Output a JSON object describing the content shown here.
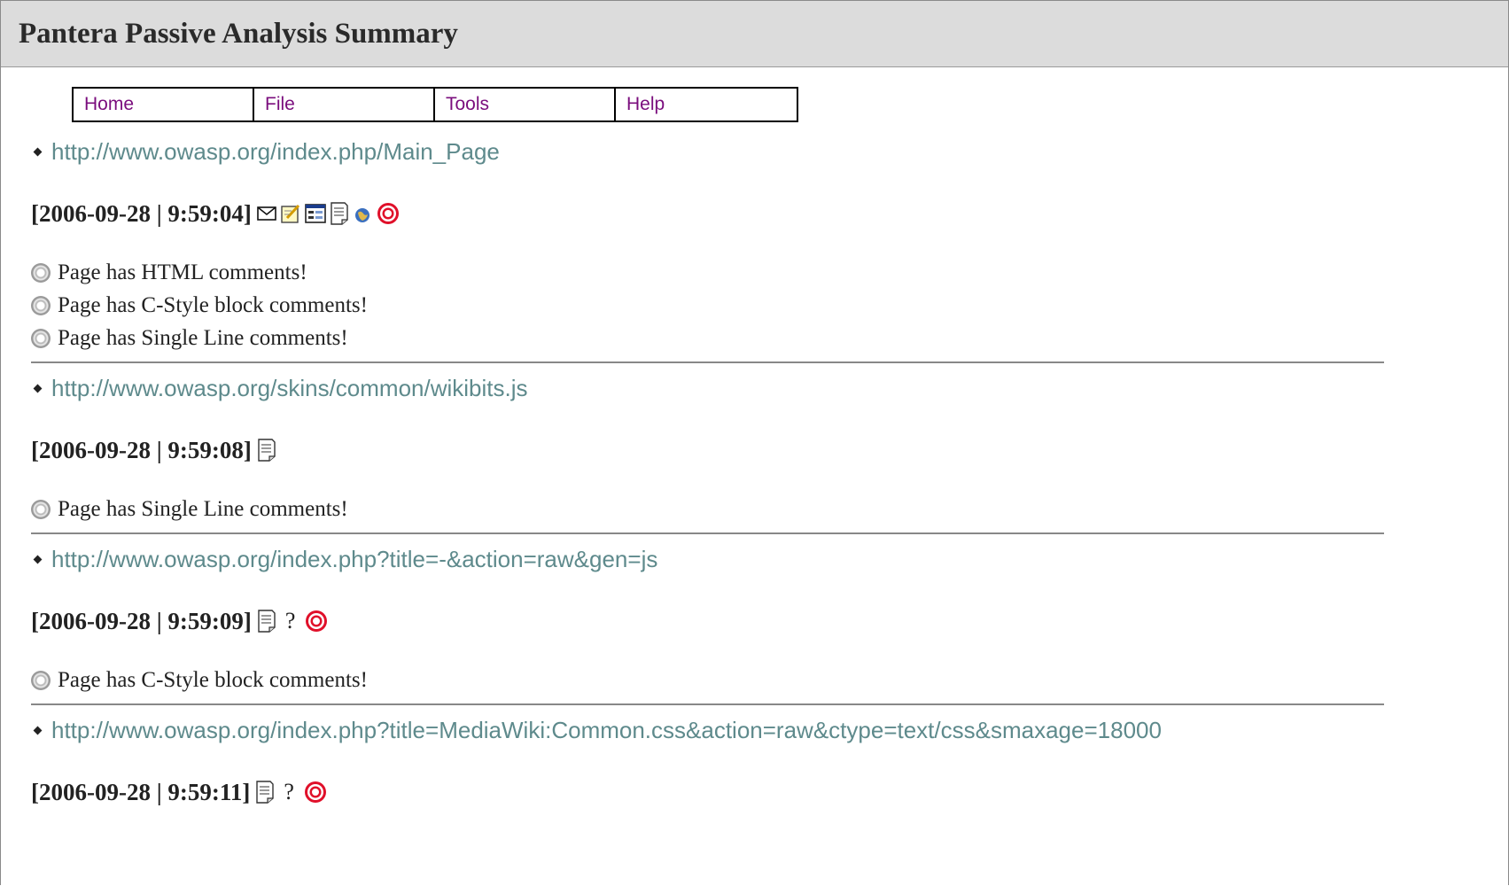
{
  "window": {
    "title": "Pantera Passive Analysis Summary"
  },
  "menu": {
    "items": [
      "Home",
      "File",
      "Tools",
      "Help"
    ]
  },
  "entries": [
    {
      "url": "http://www.owasp.org/index.php/Main_Page",
      "timestamp": "[2006-09-28 | 9:59:04]",
      "icons": [
        "mail-icon",
        "edit-icon",
        "form-icon",
        "document-icon",
        "globe-icon",
        "target-icon"
      ],
      "findings": [
        "Page has HTML comments!",
        "Page has C-Style block comments!",
        "Page has Single Line comments!"
      ]
    },
    {
      "url": "http://www.owasp.org/skins/common/wikibits.js",
      "timestamp": "[2006-09-28 | 9:59:08]",
      "icons": [
        "document-icon"
      ],
      "findings": [
        "Page has Single Line comments!"
      ]
    },
    {
      "url": "http://www.owasp.org/index.php?title=-&action=raw&gen=js",
      "timestamp": "[2006-09-28 | 9:59:09]",
      "icons": [
        "document-icon",
        "question-mark",
        "target-icon"
      ],
      "question": "?",
      "findings": [
        "Page has C-Style block comments!"
      ]
    },
    {
      "url": "http://www.owasp.org/index.php?title=MediaWiki:Common.css&action=raw&ctype=text/css&smaxage=18000",
      "timestamp": "[2006-09-28 | 9:59:11]",
      "icons": [
        "document-icon",
        "question-mark",
        "target-icon"
      ],
      "question": "?",
      "findings": []
    }
  ],
  "colors": {
    "link": "#5e8a8c",
    "menu_text": "#7a0d7d",
    "title_bar": "#dcdcdc",
    "target": "#e0102a"
  }
}
